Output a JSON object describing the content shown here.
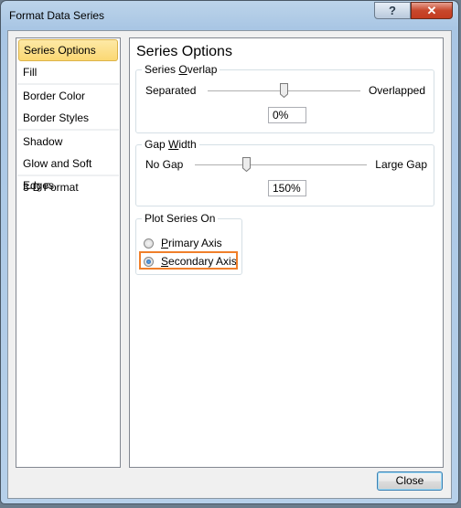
{
  "window": {
    "title": "Format Data Series",
    "help_glyph": "?",
    "close_glyph": "✕"
  },
  "sidebar": {
    "items": [
      {
        "label": "Series Options",
        "selected": true
      },
      {
        "label": "Fill"
      },
      {
        "label": "Border Color"
      },
      {
        "label": "Border Styles"
      },
      {
        "label": "Shadow"
      },
      {
        "label": "Glow and Soft Edges"
      },
      {
        "label": "3-D Format"
      }
    ]
  },
  "main": {
    "title": "Series Options",
    "overlap": {
      "legend_pre": "Series ",
      "legend_u": "O",
      "legend_post": "verlap",
      "left_label": "Separated",
      "right_label": "Overlapped",
      "value": "0%",
      "slider_fraction": 0.5
    },
    "gap": {
      "legend_pre": "Gap ",
      "legend_u": "W",
      "legend_post": "idth",
      "left_label": "No Gap",
      "right_label": "Large Gap",
      "value": "150%",
      "slider_fraction": 0.3
    },
    "plot_on": {
      "legend": "Plot Series On",
      "primary_u": "P",
      "primary_rest": "rimary Axis",
      "secondary_u": "S",
      "secondary_rest": "econdary Axis",
      "selected": "secondary"
    }
  },
  "footer": {
    "close_label": "Close"
  },
  "colors": {
    "highlight": "#f07f2a",
    "selected_item": "#fbd873"
  }
}
